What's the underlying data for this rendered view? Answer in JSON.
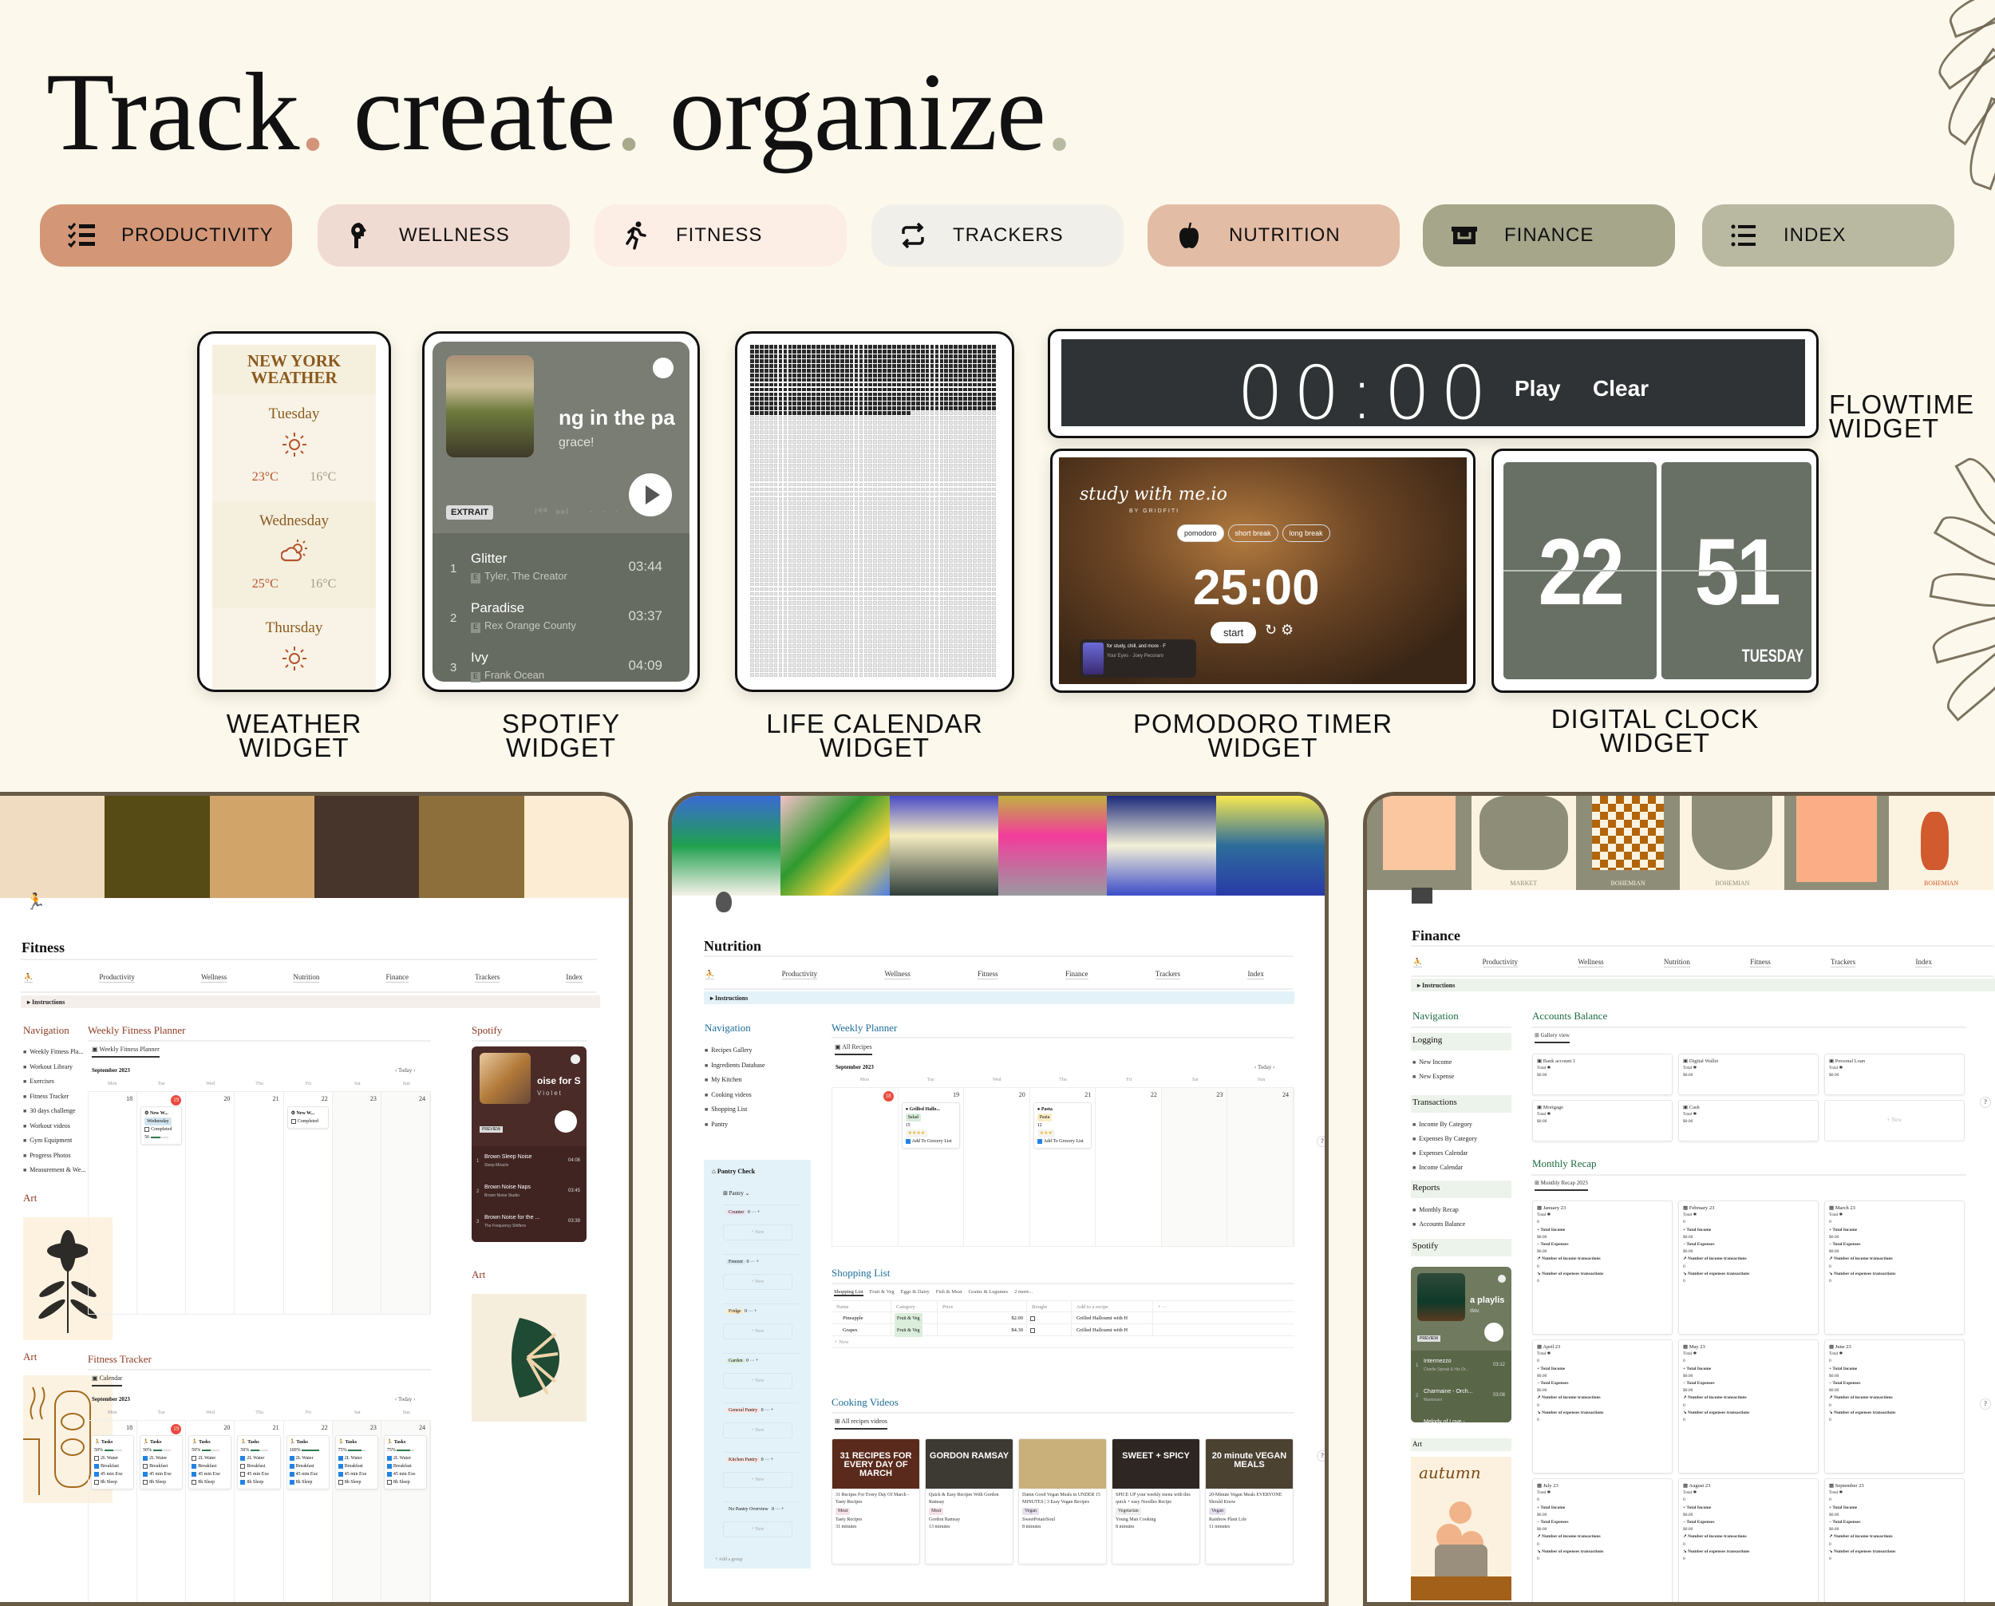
{
  "hero": {
    "words": [
      "Track",
      "create",
      "organize"
    ],
    "dot": ".",
    "dot_colors": [
      "#d3957a",
      "#a8a98d",
      "#b9baa2"
    ]
  },
  "categories": [
    {
      "label": "PRODUCTIVITY",
      "icon": "checklist-icon",
      "bg": "#d39777"
    },
    {
      "label": "WELLNESS",
      "icon": "head-icon",
      "bg": "#f0dbd2"
    },
    {
      "label": "FITNESS",
      "icon": "running-icon",
      "bg": "#fdeee5"
    },
    {
      "label": "TRACKERS",
      "icon": "repeat-icon",
      "bg": "#f1efea"
    },
    {
      "label": "NUTRITION",
      "icon": "apple-icon",
      "bg": "#e3bca6"
    },
    {
      "label": "FINANCE",
      "icon": "wallet-icon",
      "bg": "#a5a68a"
    },
    {
      "label": "INDEX",
      "icon": "list-icon",
      "bg": "#b9b9a2"
    }
  ],
  "widgets": {
    "weather": {
      "heading": [
        "NEW YORK",
        "WEATHER"
      ],
      "days": [
        {
          "day": "Tuesday",
          "icon": "sun-icon",
          "high": "23°C",
          "low": "16°C"
        },
        {
          "day": "Wednesday",
          "icon": "partly-cloudy-icon",
          "high": "25°C",
          "low": "16°C"
        },
        {
          "day": "Thursday",
          "icon": "sun-icon"
        }
      ],
      "label": [
        "WEATHER",
        "WIDGET"
      ]
    },
    "spotify": {
      "title": "ng in the pa",
      "subtitle": "grace!",
      "badge": "EXTRAIT",
      "tracks": [
        {
          "n": "1",
          "title": "Glitter",
          "artist": "Tyler, The Creator",
          "duration": "03:44"
        },
        {
          "n": "2",
          "title": "Paradise",
          "artist": "Rex Orange County",
          "duration": "03:37"
        },
        {
          "n": "3",
          "title": "Ivy",
          "artist": "Frank Ocean",
          "duration": "04:09"
        }
      ],
      "label": [
        "SPOTIFY",
        "WIDGET"
      ]
    },
    "life_calendar": {
      "columns": 52,
      "rows": 70,
      "weeks_lived": 762,
      "label": [
        "LIFE CALENDAR",
        "WIDGET"
      ]
    },
    "flowtime": {
      "time": "00:00",
      "play": "Play",
      "clear": "Clear",
      "label": [
        "FLOWTIME",
        "WIDGET"
      ]
    },
    "pomodoro": {
      "brand": "study with me.io",
      "by": "BY GRIDFITI",
      "modes": [
        "pomodoro",
        "short break",
        "long break"
      ],
      "active_mode": "pomodoro",
      "time": "25:00",
      "start": "start",
      "mini_player": "for study, chill, and more · F",
      "mini_track": "Your Eyes · Joey Pecoraro",
      "label": [
        "POMODORO TIMER",
        "WIDGET"
      ]
    },
    "clock": {
      "hours": "22",
      "minutes": "51",
      "day": "TUESDAY",
      "label": [
        "DIGITAL CLOCK",
        "WIDGET"
      ]
    }
  },
  "fitness": {
    "title": "Fitness",
    "nav": [
      "Productivity",
      "Wellness",
      "Nutrition",
      "Finance",
      "Trackers",
      "Index"
    ],
    "instructions": "Instructions",
    "navigation_heading": "Navigation",
    "navigation": [
      "Weekly Fitness Pla...",
      "Workout Library",
      "Exercises",
      "Fitness Tracker",
      "30 days challenge",
      "Workout videos",
      "Gym Equipment",
      "Progress Photos",
      "Measurement & We..."
    ],
    "art_heading": "Art",
    "planner": {
      "heading": "Weekly Fitness Planner",
      "tab": "Weekly Fitness Planner",
      "month": "September 2023",
      "today": "Today",
      "dow": [
        "Mon",
        "Tue",
        "Wed",
        "Thu",
        "Fri",
        "Sat",
        "Sun"
      ],
      "dates": [
        "18",
        "19",
        "20",
        "21",
        "22",
        "23",
        "24"
      ],
      "today_index": 1,
      "entries": [
        {
          "day": 1,
          "title": "New W...",
          "tag": "Wednesday",
          "completed": false,
          "progress_label": "56",
          "progress": 0.56
        },
        {
          "day": 4,
          "title": "New W...",
          "completed": false
        }
      ],
      "completed_label": "Completed"
    },
    "tracker": {
      "heading": "Fitness Tracker",
      "tab": "Calendar",
      "month": "September 2023",
      "today": "Today",
      "card_title": "Tasks",
      "task_labels": [
        "2L Water",
        "Breakfast",
        "45 min Exe",
        "8h Sleep"
      ],
      "days": [
        {
          "pct": "50%",
          "value": 0.5,
          "done": [
            false,
            true,
            true,
            false
          ]
        },
        {
          "pct": "50%",
          "value": 0.5,
          "done": [
            true,
            false,
            true,
            false
          ]
        },
        {
          "pct": "50%",
          "value": 0.5,
          "done": [
            false,
            true,
            true,
            false
          ]
        },
        {
          "pct": "50%",
          "value": 0.5,
          "done": [
            true,
            false,
            false,
            true
          ]
        },
        {
          "pct": "100%",
          "value": 1.0,
          "done": [
            true,
            true,
            true,
            true
          ]
        },
        {
          "pct": "75%",
          "value": 0.75,
          "done": [
            true,
            true,
            true,
            false
          ]
        },
        {
          "pct": "75%",
          "value": 0.75,
          "done": [
            true,
            true,
            true,
            false
          ]
        }
      ]
    },
    "spotify": {
      "heading": "Spotify",
      "title": "oise for S",
      "subtitle": "Violet",
      "badge": "PREVIEW",
      "tracks": [
        {
          "n": "1",
          "title": "Brown Sleep Noise",
          "artist": "Sleep Miracle",
          "duration": "04:08"
        },
        {
          "n": "2",
          "title": "Brown Noise Naps",
          "artist": "Brown Noise Studio",
          "duration": "03:45"
        },
        {
          "n": "3",
          "title": "Brown Noise for the ...",
          "artist": "The Frequency Shifters",
          "duration": "03:39"
        }
      ]
    },
    "accent": "#8c3b22"
  },
  "nutrition": {
    "title": "Nutrition",
    "nav": [
      "Productivity",
      "Wellness",
      "Fitness",
      "Finance",
      "Trackers",
      "Index"
    ],
    "instructions": "Instructions",
    "navigation_heading": "Navigation",
    "navigation": [
      "Recipes Gallery",
      "Ingredients Database",
      "My Kitchen",
      "Cooking videos",
      "Shopping List",
      "Pantry"
    ],
    "pantry": {
      "heading": "Pantry Check",
      "view": "Pantry",
      "groups": [
        {
          "name": "Counter",
          "count": "0",
          "color": "#f1dff0"
        },
        {
          "name": "Freezer",
          "count": "0",
          "color": "#d3e5ef"
        },
        {
          "name": "Fridge",
          "count": "0",
          "color": "#fbecc6"
        },
        {
          "name": "Garden",
          "count": "0",
          "color": "#dbeddb"
        },
        {
          "name": "General Pantry",
          "count": "0",
          "color": "#ffe2dd"
        },
        {
          "name": "Kitchen Pantry",
          "count": "0",
          "color": "#ffe2dd"
        },
        {
          "name": "No Pantry Overview",
          "count": "0",
          "color": ""
        }
      ],
      "new_label": "+ New",
      "add_group": "Add a group"
    },
    "planner": {
      "heading": "Weekly Planner",
      "tab": "All Recipes",
      "month": "September 2023",
      "today": "Today",
      "dow": [
        "Mon",
        "Tue",
        "Wed",
        "Thu",
        "Fri",
        "Sat",
        "Sun"
      ],
      "dates": [
        "18",
        "19",
        "20",
        "21",
        "22",
        "23",
        "24"
      ],
      "today_index": 0,
      "entries": [
        {
          "day": 1,
          "title": "Grilled Hallo...",
          "tag": "Salad",
          "tag_color": "#dbeddb",
          "number": "15",
          "stars": "★★★★",
          "grocery": "Add To Grocery List"
        },
        {
          "day": 3,
          "title": "Pasta",
          "tag": "Pasta",
          "tag_color": "#fbecc6",
          "number": "12",
          "stars": "★★★",
          "grocery": "Add To Grocery List"
        }
      ]
    },
    "shopping": {
      "heading": "Shopping List",
      "tabs": [
        "Shopping List",
        "Fruit & Veg",
        "Eggs & Dairy",
        "Fish & Meat",
        "Grains & Legumes",
        "2 more..."
      ],
      "columns": [
        "Name",
        "Category",
        "Price",
        "Bought",
        "Add to a recipe"
      ],
      "rows": [
        {
          "name": "Pineapple",
          "category": "Fruit & Veg",
          "price": "$2.00",
          "bought": false,
          "recipe": "Grilled Halloumi with H"
        },
        {
          "name": "Grapes",
          "category": "Fruit & Veg",
          "price": "$4.30",
          "bought": false,
          "recipe": "Grilled Halloumi with H"
        }
      ],
      "new_label": "+ New"
    },
    "videos": {
      "heading": "Cooking Videos",
      "tab": "All recipes videos",
      "cards": [
        {
          "thumb": "31 RECIPES FOR EVERY DAY OF MARCH",
          "thumb_bg": "#5a2a1c",
          "title": "31 Recipes For Every Day Of March - Tasty Recipes",
          "tag": "Meat",
          "tag_color": "#f5e0e9",
          "channel": "Tasty Recipes",
          "length": "31 minutes"
        },
        {
          "thumb": "GORDON RAMSAY",
          "thumb_bg": "#3d3a33",
          "title": "Quick & Easy Recipes With Gordon Ramsay",
          "tag": "Meat",
          "tag_color": "#f5e0e9",
          "channel": "Gordon Ramsay",
          "length": "13 minutes"
        },
        {
          "thumb": "",
          "thumb_bg": "#c9b07a",
          "title": "Damn Good Vegan Meals in UNDER 15 MINUTES | 3 Easy Vegan Recipes",
          "tag": "Vegan",
          "tag_color": "#e8deee",
          "channel": "SweetPotatoSoul",
          "length": "8 minutes"
        },
        {
          "thumb": "SWEET + SPICY",
          "thumb_bg": "#2d2622",
          "title": "SPICE UP your weekly menu with this quick + easy Noodles Recipe",
          "tag": "Vegetarian",
          "tag_color": "#eeeeec",
          "channel": "Young Man Cooking",
          "length": "8 minutes"
        },
        {
          "thumb": "20 minute VEGAN MEALS",
          "thumb_bg": "#4b4232",
          "title": "20-Minute Vegan Meals EVERYONE Should Know",
          "tag": "Vegan",
          "tag_color": "#e8deee",
          "channel": "Rainbow Plant Life",
          "length": "11 minutes"
        }
      ]
    },
    "accent": "#1d6d98"
  },
  "finance": {
    "title": "Finance",
    "nav": [
      "Productivity",
      "Wellness",
      "Nutrition",
      "Fitness",
      "Trackers",
      "Index"
    ],
    "instructions": "Instructions",
    "navigation_heading": "Navigation",
    "logging_heading": "Logging",
    "logging": [
      "New Income",
      "New Expense"
    ],
    "transactions_heading": "Transactions",
    "transactions": [
      "Income By Category",
      "Expenses By Category",
      "Expenses Calendar",
      "Income Calendar"
    ],
    "reports_heading": "Reports",
    "reports": [
      "Monthly Recap",
      "Accounts Balance"
    ],
    "spotify_heading": "Spotify",
    "spotify": {
      "title": "a playlis",
      "subtitle": "dav.",
      "badge": "PREVIEW",
      "tracks": [
        {
          "n": "1",
          "title": "Intermezzo",
          "artist": "Charlie Spivak & His Or...",
          "duration": "03:12"
        },
        {
          "n": "2",
          "title": "Charmaine - Orch...",
          "artist": "Mantovani",
          "duration": "03:08"
        },
        {
          "n": "3",
          "title": "Melody of Love - ...",
          "artist": "Wayne King",
          "duration": "02:44"
        }
      ]
    },
    "art_heading": "Art",
    "art_text": "autumn",
    "banner_labels": [
      "MARKET",
      "BOHEMIAN",
      "BOHEMIAN",
      "BOHEMIAN"
    ],
    "accounts": {
      "heading": "Accounts Balance",
      "tab": "Gallery view",
      "items": [
        {
          "name": "Bank account 1",
          "total_label": "Total",
          "amount": "$0.00"
        },
        {
          "name": "Digital Wallet",
          "total_label": "Total",
          "amount": "$0.00"
        },
        {
          "name": "Personal Loan",
          "total_label": "Total",
          "amount": "$0.00"
        },
        {
          "name": "Mortgage",
          "total_label": "Total",
          "amount": "$0.00"
        },
        {
          "name": "Cash",
          "total_label": "Total",
          "amount": "$0.00"
        }
      ],
      "new_label": "+ New"
    },
    "recap": {
      "heading": "Monthly Recap",
      "tab": "Monthly Recap 2023",
      "fields": [
        "Total",
        "Total Income",
        "Total Expenses",
        "Number of income transactions",
        "Number of expenses transactions"
      ],
      "months": [
        {
          "name": "January 23",
          "values": [
            "0",
            "$0.00",
            "$0.00",
            "0",
            "0"
          ]
        },
        {
          "name": "February 23",
          "values": [
            "0",
            "$0.00",
            "$0.00",
            "0",
            "0"
          ]
        },
        {
          "name": "March 23",
          "values": [
            "0",
            "$0.00",
            "$0.00",
            "0",
            "0"
          ]
        },
        {
          "name": "April 23",
          "values": [
            "0",
            "$0.00",
            "$0.00",
            "0",
            "0"
          ]
        },
        {
          "name": "May 23",
          "values": [
            "0",
            "$0.00",
            "$0.00",
            "0",
            "0"
          ]
        },
        {
          "name": "June 23",
          "values": [
            "0",
            "$0.00",
            "$0.00",
            "0",
            "0"
          ]
        },
        {
          "name": "July 23",
          "values": [
            "0",
            "$0.00",
            "$0.00",
            "0",
            "0"
          ]
        },
        {
          "name": "August 23",
          "values": [
            "0",
            "$0.00",
            "$0.00",
            "0",
            "0"
          ]
        },
        {
          "name": "September 23",
          "values": [
            "0",
            "$0.00",
            "$0.00",
            "0",
            "0"
          ]
        }
      ]
    },
    "accent": "#1e6b42"
  },
  "help_label": "?"
}
